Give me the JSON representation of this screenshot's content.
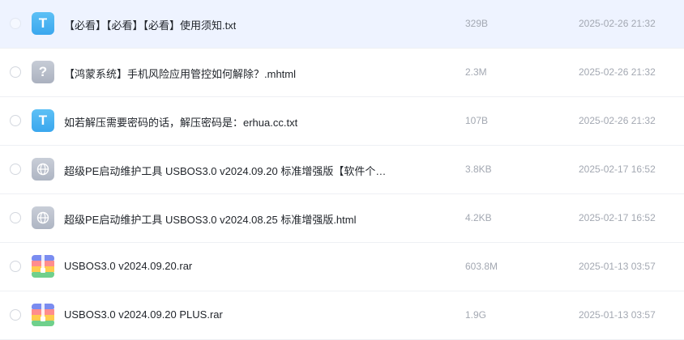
{
  "files": [
    {
      "name": "【必看】【必看】【必看】使用须知.txt",
      "size": "329B",
      "date": "2025-02-26 21:32",
      "icon": "txt-file-icon",
      "glyph": "T",
      "selected": true
    },
    {
      "name": "【鸿蒙系统】手机风险应用管控如何解除？.mhtml",
      "size": "2.3M",
      "date": "2025-02-26 21:32",
      "icon": "unknown-file-icon",
      "glyph": "?",
      "selected": false
    },
    {
      "name": "如若解压需要密码的话，解压密码是：erhua.cc.txt",
      "size": "107B",
      "date": "2025-02-26 21:32",
      "icon": "txt-file-icon",
      "glyph": "T",
      "selected": false
    },
    {
      "name": "超级PE启动维护工具 USBOS3.0 v2024.09.20 标准增强版【软件个…",
      "size": "3.8KB",
      "date": "2025-02-17 16:52",
      "icon": "web-file-icon",
      "glyph": "",
      "selected": false
    },
    {
      "name": "超级PE启动维护工具 USBOS3.0 v2024.08.25 标准增强版.html",
      "size": "4.2KB",
      "date": "2025-02-17 16:52",
      "icon": "web-file-icon",
      "glyph": "",
      "selected": false
    },
    {
      "name": "USBOS3.0 v2024.09.20.rar",
      "size": "603.8M",
      "date": "2025-01-13 03:57",
      "icon": "rar-archive-icon",
      "glyph": "",
      "selected": false
    },
    {
      "name": "USBOS3.0 v2024.09.20 PLUS.rar",
      "size": "1.9G",
      "date": "2025-01-13 03:57",
      "icon": "rar-archive-icon",
      "glyph": "",
      "selected": false
    }
  ],
  "colors": {
    "selected_row_bg": "#eef3ff",
    "txt_icon": "#3aa7ee",
    "generic_icon": "#aab1bf",
    "meta_text": "#a3a8b2",
    "name_text": "#1f2329"
  }
}
